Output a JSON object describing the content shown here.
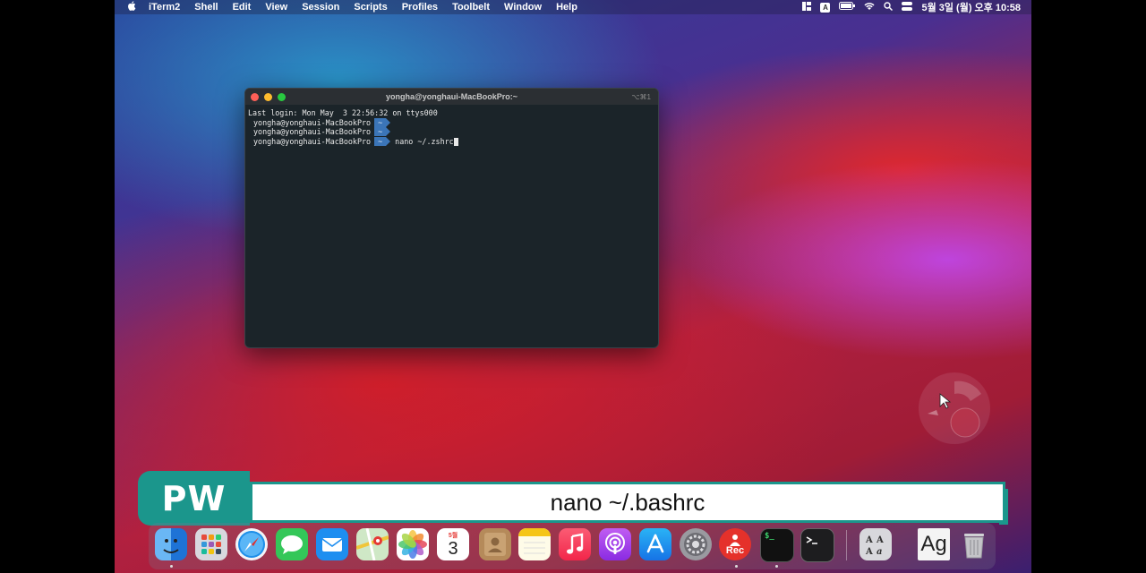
{
  "menubar": {
    "app": "iTerm2",
    "items": [
      "Shell",
      "Edit",
      "View",
      "Session",
      "Scripts",
      "Profiles",
      "Toolbelt",
      "Window",
      "Help"
    ],
    "datetime": "5월 3일 (월) 오후 10:58",
    "input_indicator": "A"
  },
  "terminal": {
    "title": "yongha@yonghaui-MacBookPro:~",
    "shortcut": "⌥⌘1",
    "last_login": "Last login: Mon May  3 22:56:32 on ttys000",
    "prompt_user": "yongha@yonghaui-MacBookPro",
    "prompt_dir": "~",
    "command": "nano ~/.zshrc"
  },
  "caption": {
    "badge": "PW",
    "text": "nano ~/.bashrc"
  },
  "dock": {
    "calendar_month": "5월",
    "calendar_day": "3",
    "rec_label": "Rec",
    "font_book_label": "Ag",
    "terminal_label": "$_"
  },
  "colors": {
    "caption_teal": "#1b968c",
    "prompt_blue": "#3b75b8"
  }
}
